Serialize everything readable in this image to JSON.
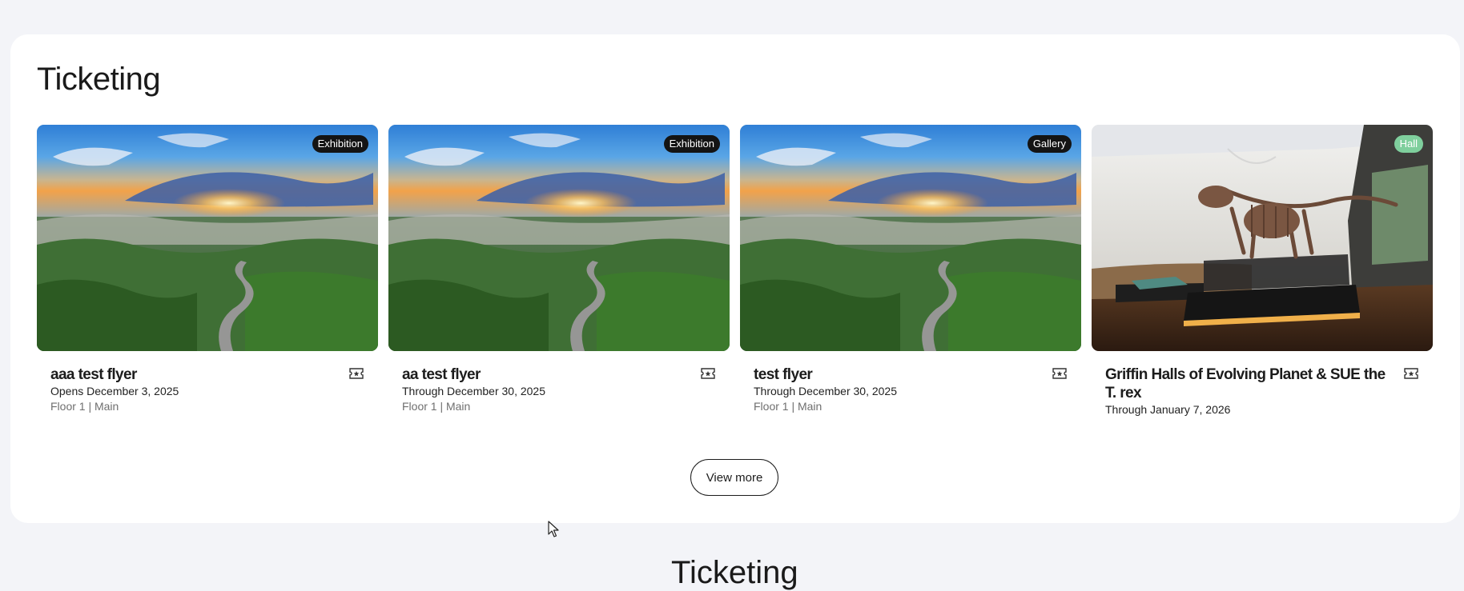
{
  "section": {
    "title": "Ticketing",
    "view_more_label": "View more"
  },
  "tiles": [
    {
      "badge": "Exhibition",
      "title": "aaa test flyer",
      "date": "Opens December 3, 2025",
      "location": "Floor 1 | Main",
      "image": "sunrise-over-rainforest",
      "icon": "ticket-icon"
    },
    {
      "badge": "Exhibition",
      "title": "aa test flyer",
      "date": "Through December 30, 2025",
      "location": "Floor 1 | Main",
      "image": "sunrise-over-rainforest",
      "icon": "ticket-icon"
    },
    {
      "badge": "Gallery",
      "title": "test flyer",
      "date": "Through December 30, 2025",
      "location": "Floor 1 | Main",
      "image": "sunrise-over-rainforest",
      "icon": "ticket-icon"
    },
    {
      "badge": "Hall",
      "title": "Griffin Halls of Evolving Planet & SUE the T. rex",
      "date": "Through January 7, 2026",
      "image": "t-rex-skeleton-hall",
      "icon": "ticket-icon"
    }
  ],
  "next_section": {
    "title": "Ticketing"
  },
  "colors": {
    "page_background": "#f3f4f8",
    "panel_background": "#ffffff",
    "badge_dark": "#141414",
    "badge_hall": "#7fcf9d",
    "text_primary": "#1c1c1c",
    "text_muted": "#6f6f6f"
  }
}
